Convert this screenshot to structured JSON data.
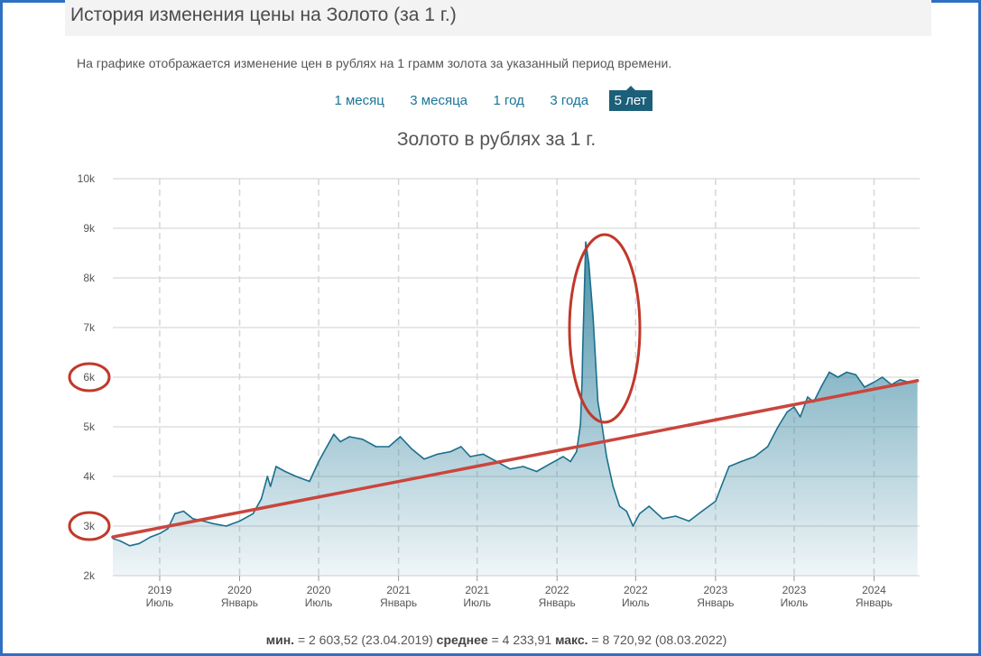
{
  "header": {
    "title": "История изменения цены на Золото (за 1 г.)"
  },
  "description": "На графике отображается изменение цен в рублях на 1 грамм золота за указанный период времени.",
  "periods": [
    {
      "label": "1 месяц",
      "active": false
    },
    {
      "label": "3 месяца",
      "active": false
    },
    {
      "label": "1 год",
      "active": false
    },
    {
      "label": "3 года",
      "active": false
    },
    {
      "label": "5 лет",
      "active": true
    }
  ],
  "stats": {
    "min_label": "мин.",
    "min_text": "= 2 603,52 (23.04.2019)",
    "avg_label": "среднее",
    "avg_text": "= 4 233,91",
    "max_label": "макс.",
    "max_text": "= 8 720,92 (08.03.2022)"
  },
  "colors": {
    "line": "#1b6f8c",
    "fill_top": "#3f8aa4",
    "trend": "#c9463d",
    "annotation": "#c0392b"
  },
  "chart_data": {
    "type": "area",
    "title": "Золото в рублях за 1 г.",
    "xlabel": "",
    "ylabel": "",
    "ylim": [
      2000,
      10000
    ],
    "grid": true,
    "yticks": [
      {
        "value": 10000,
        "label": "10k"
      },
      {
        "value": 9000,
        "label": "9k"
      },
      {
        "value": 8000,
        "label": "8k"
      },
      {
        "value": 7000,
        "label": "7k"
      },
      {
        "value": 6000,
        "label": "6k"
      },
      {
        "value": 5000,
        "label": "5k"
      },
      {
        "value": 4000,
        "label": "4k"
      },
      {
        "value": 3000,
        "label": "3k"
      },
      {
        "value": 2000,
        "label": "2k"
      }
    ],
    "xticks": [
      {
        "date": "2019-07-01",
        "year": "2019",
        "label": "Июль"
      },
      {
        "date": "2020-01-01",
        "year": "2020",
        "label": "Январь"
      },
      {
        "date": "2020-07-01",
        "year": "2020",
        "label": "Июль"
      },
      {
        "date": "2021-01-01",
        "year": "2021",
        "label": "Январь"
      },
      {
        "date": "2021-07-01",
        "year": "2021",
        "label": "Июль"
      },
      {
        "date": "2022-01-01",
        "year": "2022",
        "label": "Январь"
      },
      {
        "date": "2022-07-01",
        "year": "2022",
        "label": "Июль"
      },
      {
        "date": "2023-01-01",
        "year": "2023",
        "label": "Январь"
      },
      {
        "date": "2023-07-01",
        "year": "2023",
        "label": "Июль"
      },
      {
        "date": "2024-01-01",
        "year": "2024",
        "label": "Январь"
      }
    ],
    "x_range": [
      "2019-03-15",
      "2024-04-15"
    ],
    "series": [
      {
        "x": [
          "2019-03-15",
          "2019-04-01",
          "2019-04-23",
          "2019-05-15",
          "2019-06-10",
          "2019-07-01",
          "2019-07-20",
          "2019-08-05",
          "2019-08-25",
          "2019-09-15",
          "2019-10-10",
          "2019-11-01",
          "2019-12-01",
          "2020-01-01",
          "2020-02-01",
          "2020-02-20",
          "2020-03-05",
          "2020-03-12",
          "2020-03-25",
          "2020-04-15",
          "2020-05-10",
          "2020-06-10",
          "2020-07-01",
          "2020-07-20",
          "2020-08-05",
          "2020-08-20",
          "2020-09-10",
          "2020-10-10",
          "2020-11-10",
          "2020-12-10",
          "2021-01-05",
          "2021-02-01",
          "2021-03-01",
          "2021-04-01",
          "2021-05-01",
          "2021-05-25",
          "2021-06-15",
          "2021-07-15",
          "2021-08-15",
          "2021-09-15",
          "2021-10-15",
          "2021-11-15",
          "2021-12-15",
          "2022-01-15",
          "2022-02-01",
          "2022-02-15",
          "2022-02-24",
          "2022-02-28",
          "2022-03-01",
          "2022-03-08",
          "2022-03-15",
          "2022-03-25",
          "2022-04-05",
          "2022-04-15",
          "2022-04-25",
          "2022-05-10",
          "2022-05-25",
          "2022-06-10",
          "2022-06-25",
          "2022-07-10",
          "2022-08-01",
          "2022-09-01",
          "2022-10-01",
          "2022-11-01",
          "2022-12-01",
          "2023-01-01",
          "2023-02-01",
          "2023-03-01",
          "2023-04-01",
          "2023-05-01",
          "2023-05-25",
          "2023-06-15",
          "2023-07-01",
          "2023-07-15",
          "2023-08-01",
          "2023-08-15",
          "2023-09-01",
          "2023-09-20",
          "2023-10-10",
          "2023-10-30",
          "2023-11-20",
          "2023-12-10",
          "2024-01-01",
          "2024-01-20",
          "2024-02-10",
          "2024-03-01",
          "2024-03-20",
          "2024-04-10"
        ],
        "values": [
          2750,
          2700,
          2603.52,
          2650,
          2780,
          2850,
          2950,
          3250,
          3300,
          3150,
          3100,
          3050,
          3000,
          3100,
          3250,
          3550,
          4000,
          3800,
          4200,
          4100,
          4000,
          3900,
          4300,
          4600,
          4850,
          4700,
          4800,
          4750,
          4600,
          4600,
          4800,
          4550,
          4350,
          4450,
          4500,
          4600,
          4400,
          4450,
          4300,
          4150,
          4200,
          4100,
          4250,
          4400,
          4300,
          4500,
          5050,
          6000,
          6500,
          8720.92,
          8300,
          7200,
          5500,
          5000,
          4400,
          3800,
          3400,
          3300,
          3000,
          3250,
          3400,
          3150,
          3200,
          3100,
          3300,
          3500,
          4200,
          4300,
          4400,
          4600,
          5000,
          5300,
          5400,
          5200,
          5600,
          5500,
          5800,
          6100,
          6000,
          6100,
          6050,
          5800,
          5900,
          6000,
          5850,
          5950,
          5900,
          5950
        ]
      }
    ],
    "trendline": {
      "start": {
        "x": "2019-03-15",
        "y": 2780
      },
      "end": {
        "x": "2024-04-10",
        "y": 5930
      }
    },
    "annotations": [
      "circle around 6k tick label",
      "circle around 3k tick label",
      "ellipse around March 2022 peak"
    ]
  }
}
